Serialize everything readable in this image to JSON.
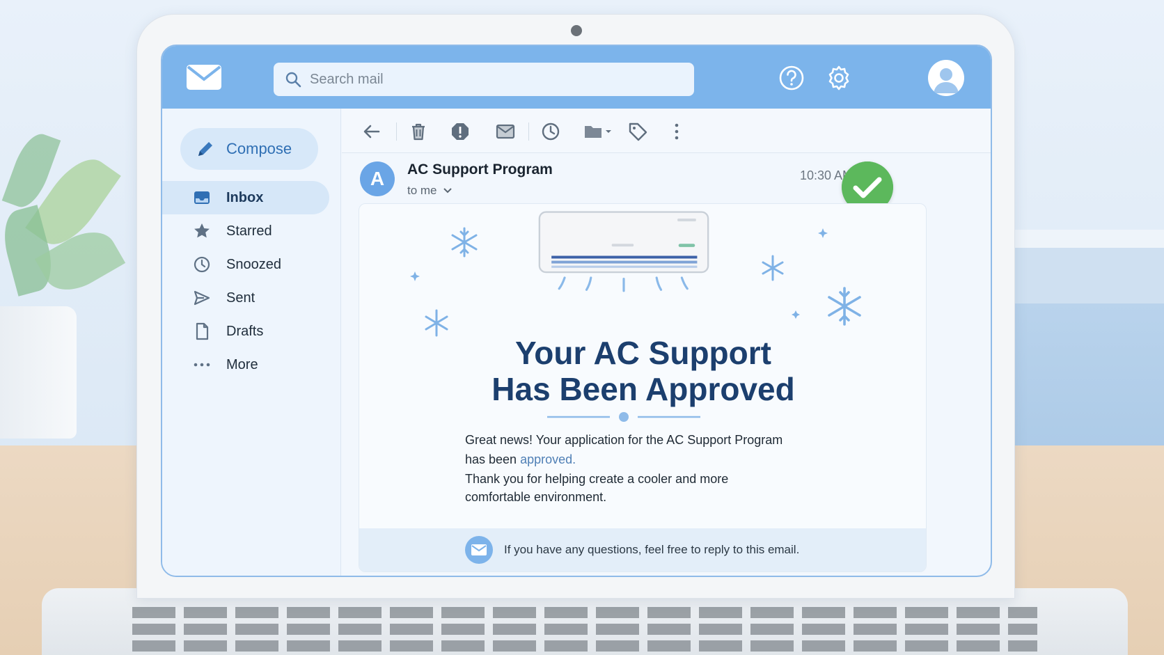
{
  "app": {
    "search_placeholder": "Search mail"
  },
  "sidebar": {
    "compose_label": "Compose",
    "items": [
      {
        "label": "Inbox",
        "icon": "inbox-icon",
        "active": true
      },
      {
        "label": "Starred",
        "icon": "star-icon"
      },
      {
        "label": "Snoozed",
        "icon": "clock-icon"
      },
      {
        "label": "Sent",
        "icon": "send-icon"
      },
      {
        "label": "Drafts",
        "icon": "draft-icon"
      },
      {
        "label": "More",
        "icon": "more-dots-icon"
      }
    ]
  },
  "toolbar": {
    "buttons": [
      "back-arrow-icon",
      "trash-icon",
      "report-spam-icon",
      "mark-unread-icon",
      "snooze-clock-icon",
      "move-folder-icon",
      "label-tag-icon",
      "more-vert-icon"
    ]
  },
  "message": {
    "sender_initial": "A",
    "sender_name": "AC Support Program",
    "recipient": "to me",
    "time": "10:30 AM",
    "headline_line1": "Your AC Support",
    "headline_line2": "Has Been Approved",
    "body_line1": "Great news! Your application for the AC Support Program",
    "body_line2_prefix": "has been ",
    "body_line2_highlight": "approved.",
    "body_line3": "Thank you for helping create a cooler and more",
    "body_line4": "comfortable environment.",
    "footer_text": "If you have any questions, feel free to reply to this email."
  },
  "colors": {
    "topbar": "#7cb4eb",
    "accent": "#2f6fb4",
    "headline": "#1c3f6e",
    "success": "#5cb85c"
  }
}
